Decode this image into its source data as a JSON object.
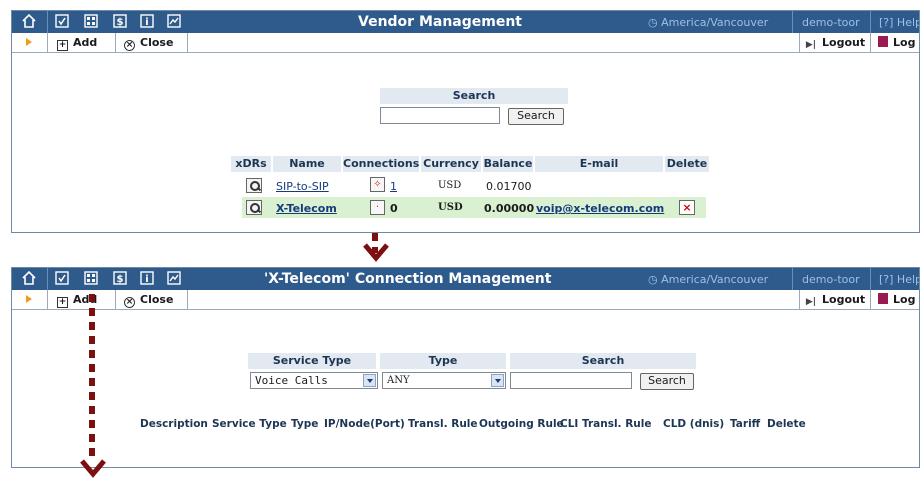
{
  "colors": {
    "header_bg": "#2e5a8c",
    "accent_orange": "#f39a1e",
    "dotted_arrow": "#7c0f0f",
    "highlight_row": "#d9f0d1"
  },
  "top_panel": {
    "title": "Vendor Management",
    "timezone": "America/Vancouver",
    "user": "demo-toor",
    "help": "Help",
    "toolbar": {
      "add": "Add",
      "close": "Close",
      "logout": "Logout",
      "log": "Log"
    },
    "search": {
      "header": "Search",
      "value": "",
      "button": "Search"
    },
    "table": {
      "headers": [
        "xDRs",
        "Name",
        "Connections",
        "Currency",
        "Balance",
        "E-mail",
        "Delete"
      ],
      "rows": [
        {
          "name": "SIP-to-SIP",
          "connections": "1",
          "currency": "USD",
          "balance": "0.01700",
          "email": ""
        },
        {
          "name": "X-Telecom",
          "connections": "0",
          "currency": "USD",
          "balance": "0.00000",
          "email": "voip@x-telecom.com"
        }
      ]
    }
  },
  "bottom_panel": {
    "title": "'X-Telecom' Connection Management",
    "timezone": "America/Vancouver",
    "user": "demo-toor",
    "help": "Help",
    "toolbar": {
      "add": "Add",
      "close": "Close",
      "logout": "Logout",
      "log": "Log"
    },
    "filters": {
      "service_type_header": "Service Type",
      "service_type_value": "Voice Calls",
      "type_header": "Type",
      "type_value": "ANY",
      "search_header": "Search",
      "search_value": "",
      "search_button": "Search"
    },
    "columns": [
      "Description",
      "Service Type",
      "Type",
      "IP/Node(Port)",
      "Transl. Rule",
      "Outgoing Rule",
      "CLI Transl. Rule",
      "CLD (dnis)",
      "Tariff",
      "Delete"
    ]
  },
  "icons": [
    "home-icon",
    "checkbox-icon",
    "grid-icon",
    "dollar-icon",
    "info-icon",
    "chart-icon",
    "clock-icon",
    "help-icon",
    "add-icon",
    "close-icon",
    "logout-icon",
    "log-icon"
  ]
}
